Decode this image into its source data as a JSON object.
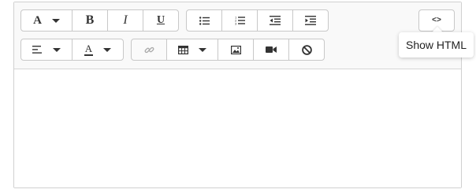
{
  "toolbar": {
    "font_button": {
      "glyph": "A",
      "icon": "font-icon"
    },
    "bold": {
      "glyph": "B",
      "icon": "bold-icon"
    },
    "italic": {
      "glyph": "I",
      "icon": "italic-icon"
    },
    "underline": {
      "glyph": "U",
      "icon": "underline-icon"
    },
    "unordered_list": {
      "icon": "bulleted-list-icon"
    },
    "ordered_list": {
      "icon": "numbered-list-icon"
    },
    "outdent": {
      "icon": "outdent-icon"
    },
    "indent": {
      "icon": "indent-icon"
    },
    "code_view": {
      "label": "<>",
      "icon": "code-view-icon"
    },
    "align": {
      "icon": "align-left-icon"
    },
    "font_color": {
      "glyph": "A",
      "icon": "font-color-icon"
    },
    "link": {
      "icon": "link-icon",
      "disabled": true
    },
    "table": {
      "icon": "table-icon"
    },
    "image": {
      "icon": "image-icon"
    },
    "video": {
      "icon": "video-icon"
    },
    "clear_formatting": {
      "icon": "clear-formatting-icon"
    }
  },
  "tooltip": {
    "text": "Show HTML"
  },
  "editor": {
    "content": ""
  },
  "colors": {
    "toolbar_bg": "#f9f9f9",
    "border": "#c8c8c8",
    "icon": "#333333",
    "disabled_icon": "#aaaaaa"
  }
}
